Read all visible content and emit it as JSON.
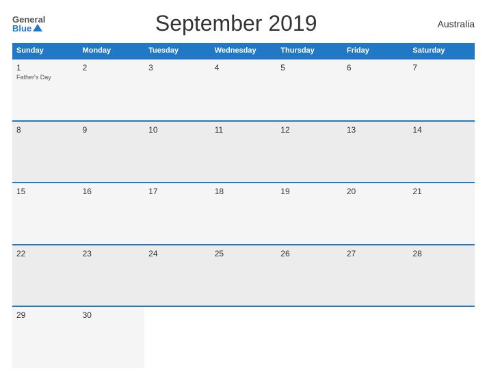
{
  "header": {
    "logo_general": "General",
    "logo_blue": "Blue",
    "title": "September 2019",
    "country": "Australia"
  },
  "calendar": {
    "days_of_week": [
      "Sunday",
      "Monday",
      "Tuesday",
      "Wednesday",
      "Thursday",
      "Friday",
      "Saturday"
    ],
    "weeks": [
      [
        {
          "day": "1",
          "holiday": "Father's Day"
        },
        {
          "day": "2",
          "holiday": ""
        },
        {
          "day": "3",
          "holiday": ""
        },
        {
          "day": "4",
          "holiday": ""
        },
        {
          "day": "5",
          "holiday": ""
        },
        {
          "day": "6",
          "holiday": ""
        },
        {
          "day": "7",
          "holiday": ""
        }
      ],
      [
        {
          "day": "8",
          "holiday": ""
        },
        {
          "day": "9",
          "holiday": ""
        },
        {
          "day": "10",
          "holiday": ""
        },
        {
          "day": "11",
          "holiday": ""
        },
        {
          "day": "12",
          "holiday": ""
        },
        {
          "day": "13",
          "holiday": ""
        },
        {
          "day": "14",
          "holiday": ""
        }
      ],
      [
        {
          "day": "15",
          "holiday": ""
        },
        {
          "day": "16",
          "holiday": ""
        },
        {
          "day": "17",
          "holiday": ""
        },
        {
          "day": "18",
          "holiday": ""
        },
        {
          "day": "19",
          "holiday": ""
        },
        {
          "day": "20",
          "holiday": ""
        },
        {
          "day": "21",
          "holiday": ""
        }
      ],
      [
        {
          "day": "22",
          "holiday": ""
        },
        {
          "day": "23",
          "holiday": ""
        },
        {
          "day": "24",
          "holiday": ""
        },
        {
          "day": "25",
          "holiday": ""
        },
        {
          "day": "26",
          "holiday": ""
        },
        {
          "day": "27",
          "holiday": ""
        },
        {
          "day": "28",
          "holiday": ""
        }
      ],
      [
        {
          "day": "29",
          "holiday": ""
        },
        {
          "day": "30",
          "holiday": ""
        },
        {
          "day": "",
          "holiday": ""
        },
        {
          "day": "",
          "holiday": ""
        },
        {
          "day": "",
          "holiday": ""
        },
        {
          "day": "",
          "holiday": ""
        },
        {
          "day": "",
          "holiday": ""
        }
      ]
    ]
  }
}
